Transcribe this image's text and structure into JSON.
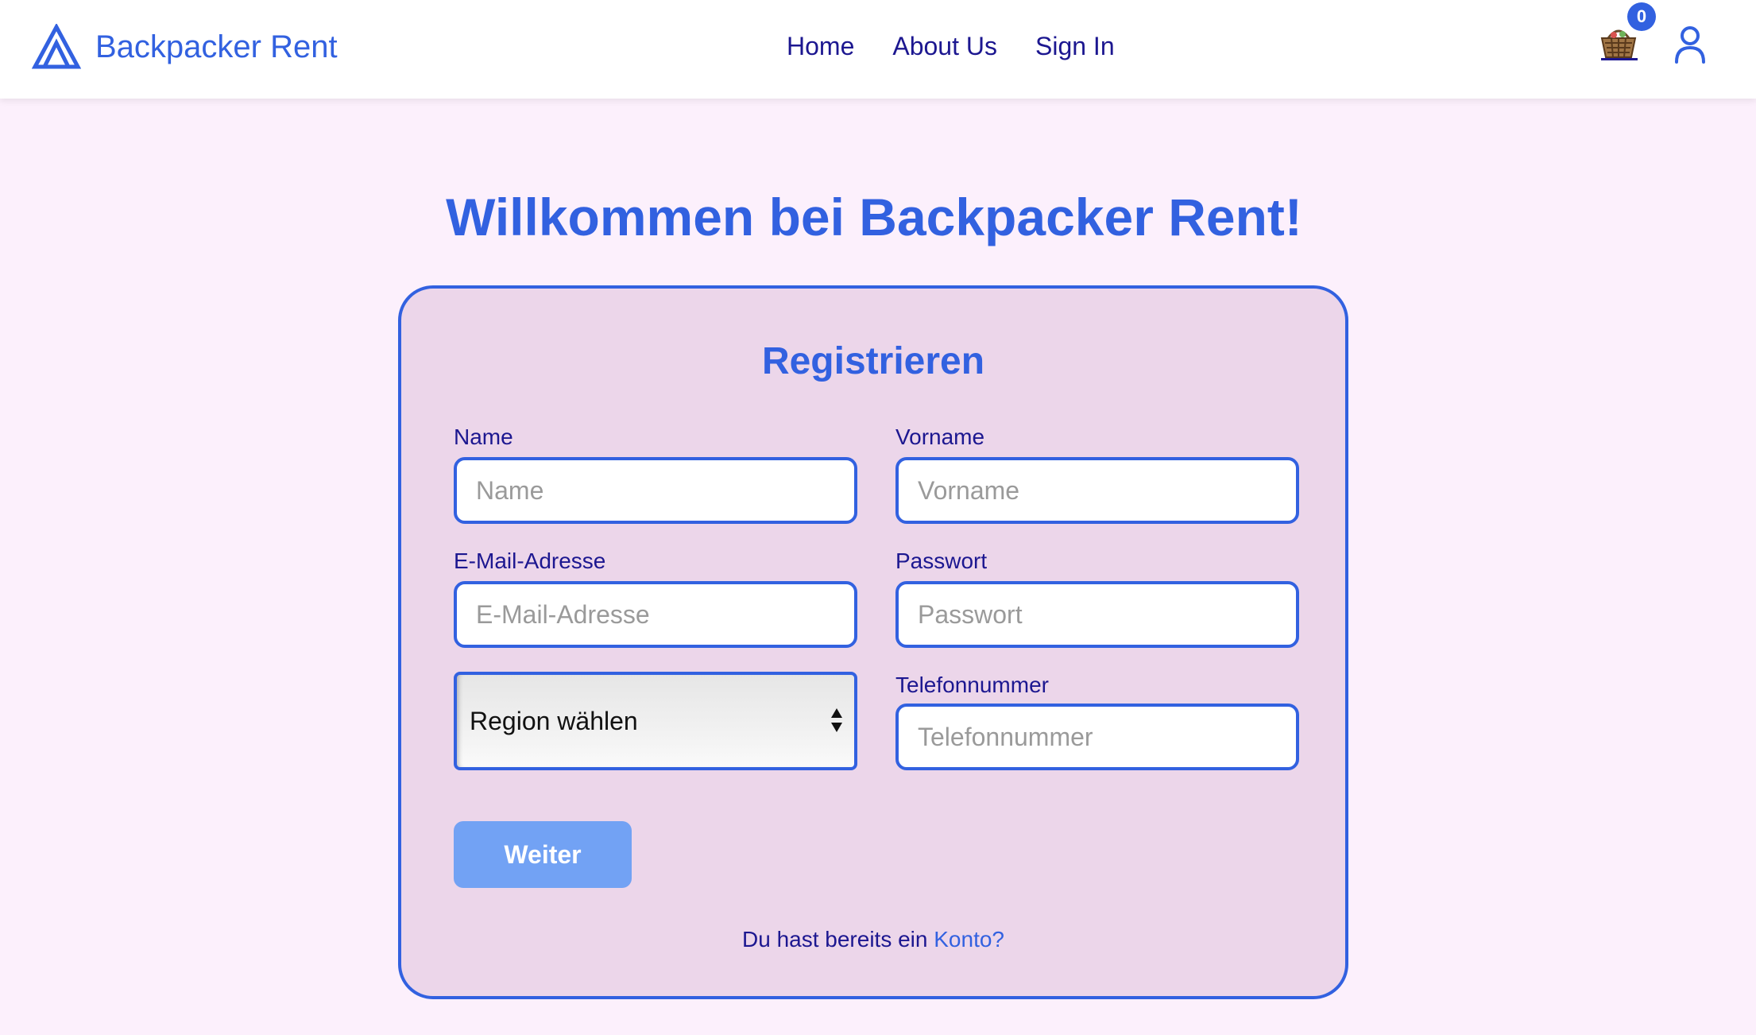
{
  "nav": {
    "brand": "Backpacker Rent",
    "links": [
      "Home",
      "About Us",
      "Sign In"
    ],
    "cart_count": "0",
    "icons": [
      "logo-triangle-icon",
      "cart-basket-icon",
      "user-icon"
    ]
  },
  "page": {
    "title": "Willkommen bei Backpacker Rent!"
  },
  "form": {
    "title": "Registrieren",
    "name_label": "Name",
    "name_placeholder": "Name",
    "vorname_label": "Vorname",
    "vorname_placeholder": "Vorname",
    "email_label": "E-Mail-Adresse",
    "email_placeholder": "E-Mail-Adresse",
    "passwort_label": "Passwort",
    "passwort_placeholder": "Passwort",
    "region_value": "Region wählen",
    "telefon_label": "Telefonnummer",
    "telefon_placeholder": "Telefonnummer",
    "submit_label": "Weiter",
    "footer_text": "Du hast bereits ein",
    "footer_link": "Konto?"
  },
  "colors": {
    "accent": "#3261e0",
    "nav_text": "#1c1790",
    "page_bg": "#fcf0fc",
    "card_bg": "#ecd6ea",
    "button_bg": "#72a2f4"
  }
}
